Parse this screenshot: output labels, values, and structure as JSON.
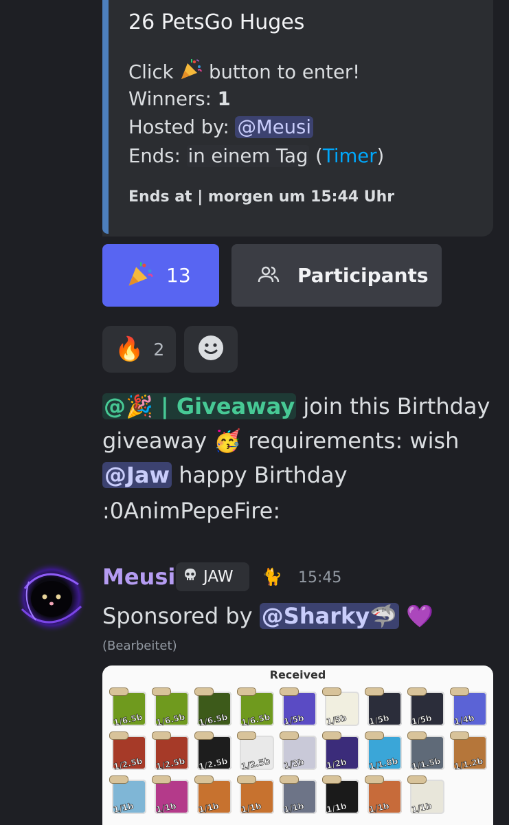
{
  "embed": {
    "title": "26 PetsGo Huges",
    "click_before": "Click ",
    "click_after": " button to enter!",
    "winners_label": "Winners: ",
    "winners_value": "1",
    "hosted_label": "Hosted by: ",
    "hosted_by": "@Meusi",
    "ends_label": "Ends: ",
    "ends_value": "in einem Tag",
    "timer_open": " (",
    "timer_link": "Timer",
    "timer_close": ")",
    "footer": "Ends at | morgen um 15:44 Uhr"
  },
  "buttons": {
    "enter_count": "13",
    "participants_label": "Participants"
  },
  "reactions": [
    {
      "emoji": "🔥",
      "count": "2"
    }
  ],
  "message": {
    "role_mention": "@🎉 | Giveaway",
    "line1_rest": " join this Birthday",
    "line2_before": "giveaway ",
    "line2_emoji": "🥳",
    "line2_after": " requirements: wish",
    "user_mention": "@Jaw",
    "line3_rest": " happy Birthday",
    "line4": ":0AnimPepeFire:"
  },
  "author": {
    "name": "Meusi",
    "tag": "JAW",
    "tag_icon": "skull-icon",
    "extra_emoji": "🐈",
    "timestamp": "15:45",
    "sponsored_prefix": "Sponsored by ",
    "sponsor_mention": "@Sharky🦈",
    "heart": "💜",
    "edited": "(Bearbeitet)"
  },
  "attachment": {
    "title": "Received",
    "rows": [
      [
        "1/6.5b",
        "1/6.5b",
        "1/6.5b",
        "1/6.5b",
        "1/5b",
        "1/5b",
        "1/5b",
        "1/5b",
        "1/4b"
      ],
      [
        "1/2.5b",
        "1/2.5b",
        "1/2.5b",
        "1/2.5b",
        "1/2b",
        "1/2b",
        "1/1.8b",
        "1/1.5b",
        "1/1.2b"
      ],
      [
        "1/1b",
        "1/1b",
        "1/1b",
        "1/1b",
        "1/1b",
        "1/1b",
        "1/1b",
        "1/1b"
      ]
    ],
    "tile_colors": [
      [
        "#6f9a1e",
        "#6f9a1e",
        "#3d5a1a",
        "#6f9a1e",
        "#5a4bc4",
        "#f1efe0",
        "#2b2d3a",
        "#2b2d3a",
        "#5b63d6"
      ],
      [
        "#a63a28",
        "#a63a28",
        "#1d1d1d",
        "#e9e9e9",
        "#c9c9d8",
        "#3b2c7a",
        "#3aa6d8",
        "#5f6a78",
        "#b5763a"
      ],
      [
        "#7fb6d6",
        "#b43a8a",
        "#c7722f",
        "#c7722f",
        "#6d7487",
        "#1a1a1a",
        "#c76b3a",
        "#e8e6da"
      ]
    ]
  },
  "colors": {
    "background": "#1e1f24",
    "embed_bar": "#4d7fbd",
    "blurple": "#5865f2",
    "author_name": "#b59cf2",
    "role_green": "#47c995"
  }
}
